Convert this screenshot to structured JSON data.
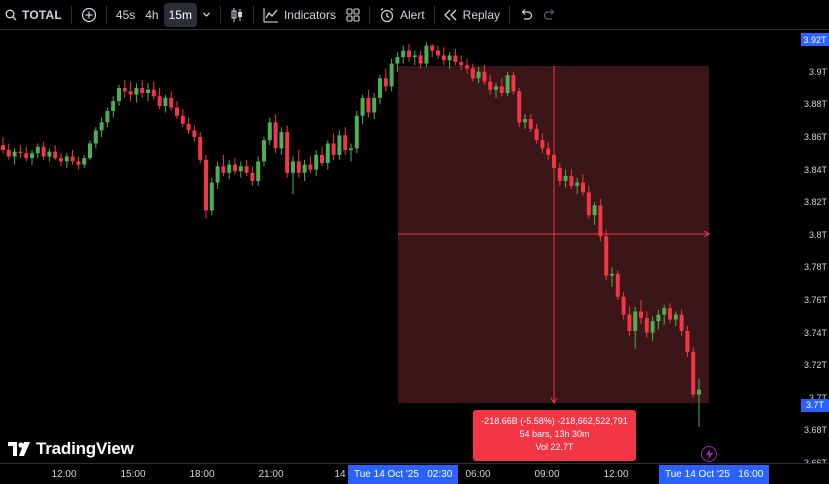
{
  "toolbar": {
    "symbol": "TOTAL",
    "intervals": [
      "45s",
      "4h",
      "15m"
    ],
    "active_interval": "15m",
    "indicators_label": "Indicators",
    "alert_label": "Alert",
    "replay_label": "Replay"
  },
  "price_axis": {
    "ticks": [
      "3.92T",
      "3.9T",
      "3.88T",
      "3.86T",
      "3.84T",
      "3.82T",
      "3.8T",
      "3.78T",
      "3.76T",
      "3.74T",
      "3.72T",
      "3.7T",
      "3.68T",
      "3.66T"
    ],
    "top_badge": "3.92T",
    "last_badge": "3.7T"
  },
  "time_axis": {
    "ticks": [
      "12:00",
      "15:00",
      "18:00",
      "21:00",
      "14",
      "06:00",
      "09:00",
      "12:00",
      "00"
    ],
    "start_badge": "Tue 14 Oct '25   02:30",
    "end_badge": "Tue 14 Oct '25   16:00"
  },
  "measure": {
    "line1": "-218.66B (-5.58%) -218,662,522,791",
    "line2": "54 bars, 13h 30m",
    "line3": "Vol 22.7T"
  },
  "logo": {
    "text": "TradingView"
  },
  "colors": {
    "up": "#26a69a",
    "up_candle": "#4caf50",
    "down": "#f23645",
    "accent": "#2962ff",
    "measure_fill": "#3b1618"
  },
  "chart_data": {
    "type": "candlestick",
    "interval": "15m",
    "ylim": [
      3.66,
      3.925
    ],
    "candles": [
      [
        3.855,
        3.86,
        3.85,
        3.852
      ],
      [
        3.852,
        3.856,
        3.846,
        3.848
      ],
      [
        3.848,
        3.853,
        3.843,
        3.851
      ],
      [
        3.851,
        3.855,
        3.847,
        3.85
      ],
      [
        3.85,
        3.854,
        3.845,
        3.847
      ],
      [
        3.847,
        3.852,
        3.843,
        3.85
      ],
      [
        3.85,
        3.856,
        3.847,
        3.854
      ],
      [
        3.854,
        3.857,
        3.846,
        3.848
      ],
      [
        3.848,
        3.853,
        3.845,
        3.851
      ],
      [
        3.851,
        3.855,
        3.846,
        3.847
      ],
      [
        3.847,
        3.85,
        3.842,
        3.845
      ],
      [
        3.845,
        3.85,
        3.841,
        3.848
      ],
      [
        3.848,
        3.852,
        3.843,
        3.845
      ],
      [
        3.845,
        3.848,
        3.84,
        3.843
      ],
      [
        3.843,
        3.849,
        3.841,
        3.847
      ],
      [
        3.847,
        3.858,
        3.846,
        3.856
      ],
      [
        3.856,
        3.866,
        3.853,
        3.864
      ],
      [
        3.864,
        3.872,
        3.86,
        3.869
      ],
      [
        3.869,
        3.878,
        3.866,
        3.876
      ],
      [
        3.876,
        3.885,
        3.872,
        3.882
      ],
      [
        3.882,
        3.892,
        3.879,
        3.89
      ],
      [
        3.89,
        3.895,
        3.884,
        3.888
      ],
      [
        3.888,
        3.894,
        3.882,
        3.886
      ],
      [
        3.886,
        3.893,
        3.881,
        3.89
      ],
      [
        3.89,
        3.895,
        3.884,
        3.887
      ],
      [
        3.887,
        3.893,
        3.882,
        3.889
      ],
      [
        3.889,
        3.894,
        3.883,
        3.885
      ],
      [
        3.885,
        3.89,
        3.877,
        3.879
      ],
      [
        3.879,
        3.886,
        3.875,
        3.884
      ],
      [
        3.884,
        3.888,
        3.876,
        3.878
      ],
      [
        3.878,
        3.882,
        3.871,
        3.873
      ],
      [
        3.873,
        3.877,
        3.866,
        3.868
      ],
      [
        3.868,
        3.872,
        3.862,
        3.864
      ],
      [
        3.864,
        3.867,
        3.857,
        3.86
      ],
      [
        3.86,
        3.863,
        3.844,
        3.846
      ],
      [
        3.846,
        3.849,
        3.81,
        3.815
      ],
      [
        3.815,
        3.835,
        3.812,
        3.832
      ],
      [
        3.832,
        3.845,
        3.828,
        3.842
      ],
      [
        3.842,
        3.849,
        3.836,
        3.838
      ],
      [
        3.838,
        3.846,
        3.834,
        3.843
      ],
      [
        3.843,
        3.847,
        3.837,
        3.839
      ],
      [
        3.839,
        3.845,
        3.835,
        3.842
      ],
      [
        3.842,
        3.846,
        3.836,
        3.838
      ],
      [
        3.838,
        3.842,
        3.83,
        3.833
      ],
      [
        3.833,
        3.848,
        3.83,
        3.845
      ],
      [
        3.845,
        3.86,
        3.842,
        3.858
      ],
      [
        3.858,
        3.872,
        3.855,
        3.869
      ],
      [
        3.869,
        3.874,
        3.85,
        3.853
      ],
      [
        3.853,
        3.866,
        3.849,
        3.863
      ],
      [
        3.863,
        3.867,
        3.835,
        3.838
      ],
      [
        3.838,
        3.848,
        3.825,
        3.845
      ],
      [
        3.845,
        3.852,
        3.835,
        3.838
      ],
      [
        3.838,
        3.846,
        3.833,
        3.843
      ],
      [
        3.843,
        3.848,
        3.838,
        3.84
      ],
      [
        3.84,
        3.852,
        3.836,
        3.849
      ],
      [
        3.849,
        3.854,
        3.842,
        3.844
      ],
      [
        3.844,
        3.858,
        3.84,
        3.856
      ],
      [
        3.856,
        3.862,
        3.846,
        3.849
      ],
      [
        3.849,
        3.864,
        3.846,
        3.861
      ],
      [
        3.861,
        3.866,
        3.849,
        3.852
      ],
      [
        3.852,
        3.856,
        3.845,
        3.853
      ],
      [
        3.853,
        3.876,
        3.85,
        3.873
      ],
      [
        3.873,
        3.886,
        3.868,
        3.884
      ],
      [
        3.884,
        3.889,
        3.872,
        3.875
      ],
      [
        3.875,
        3.887,
        3.871,
        3.884
      ],
      [
        3.884,
        3.898,
        3.88,
        3.896
      ],
      [
        3.896,
        3.902,
        3.888,
        3.891
      ],
      [
        3.891,
        3.908,
        3.888,
        3.905
      ],
      [
        3.905,
        3.912,
        3.9,
        3.909
      ],
      [
        3.909,
        3.916,
        3.905,
        3.913
      ],
      [
        3.913,
        3.917,
        3.906,
        3.909
      ],
      [
        3.909,
        3.913,
        3.904,
        3.91
      ],
      [
        3.91,
        3.913,
        3.902,
        3.905
      ],
      [
        3.905,
        3.918,
        3.903,
        3.916
      ],
      [
        3.916,
        3.917,
        3.909,
        3.913
      ],
      [
        3.913,
        3.916,
        3.908,
        3.91
      ],
      [
        3.91,
        3.915,
        3.904,
        3.907
      ],
      [
        3.907,
        3.912,
        3.902,
        3.91
      ],
      [
        3.91,
        3.914,
        3.904,
        3.906
      ],
      [
        3.906,
        3.91,
        3.901,
        3.904
      ],
      [
        3.904,
        3.908,
        3.899,
        3.902
      ],
      [
        3.902,
        3.905,
        3.894,
        3.896
      ],
      [
        3.896,
        3.903,
        3.893,
        3.9
      ],
      [
        3.9,
        3.904,
        3.892,
        3.894
      ],
      [
        3.894,
        3.898,
        3.886,
        3.889
      ],
      [
        3.889,
        3.893,
        3.884,
        3.891
      ],
      [
        3.891,
        3.896,
        3.885,
        3.887
      ],
      [
        3.887,
        3.9,
        3.885,
        3.898
      ],
      [
        3.898,
        3.9,
        3.886,
        3.888
      ],
      [
        3.888,
        3.89,
        3.866,
        3.869
      ],
      [
        3.869,
        3.874,
        3.865,
        3.871
      ],
      [
        3.871,
        3.874,
        3.863,
        3.865
      ],
      [
        3.865,
        3.868,
        3.856,
        3.858
      ],
      [
        3.858,
        3.862,
        3.85,
        3.853
      ],
      [
        3.853,
        3.857,
        3.846,
        3.849
      ],
      [
        3.849,
        3.852,
        3.838,
        3.841
      ],
      [
        3.841,
        3.844,
        3.83,
        3.833
      ],
      [
        3.833,
        3.84,
        3.829,
        3.836
      ],
      [
        3.836,
        3.84,
        3.828,
        3.83
      ],
      [
        3.83,
        3.835,
        3.825,
        3.832
      ],
      [
        3.832,
        3.837,
        3.824,
        3.826
      ],
      [
        3.826,
        3.83,
        3.81,
        3.812
      ],
      [
        3.812,
        3.82,
        3.806,
        3.818
      ],
      [
        3.818,
        3.822,
        3.796,
        3.799
      ],
      [
        3.799,
        3.803,
        3.772,
        3.775
      ],
      [
        3.775,
        3.78,
        3.768,
        3.776
      ],
      [
        3.776,
        3.778,
        3.76,
        3.762
      ],
      [
        3.762,
        3.765,
        3.748,
        3.751
      ],
      [
        3.751,
        3.756,
        3.738,
        3.741
      ],
      [
        3.741,
        3.756,
        3.73,
        3.753
      ],
      [
        3.753,
        3.76,
        3.745,
        3.749
      ],
      [
        3.749,
        3.753,
        3.737,
        3.74
      ],
      [
        3.74,
        3.75,
        3.735,
        3.747
      ],
      [
        3.747,
        3.754,
        3.742,
        3.751
      ],
      [
        3.751,
        3.757,
        3.745,
        3.755
      ],
      [
        3.755,
        3.758,
        3.746,
        3.748
      ],
      [
        3.748,
        3.753,
        3.744,
        3.751
      ],
      [
        3.751,
        3.754,
        3.738,
        3.741
      ],
      [
        3.741,
        3.744,
        3.725,
        3.728
      ],
      [
        3.728,
        3.731,
        3.7,
        3.702
      ],
      [
        3.702,
        3.712,
        3.682,
        3.705
      ]
    ]
  }
}
